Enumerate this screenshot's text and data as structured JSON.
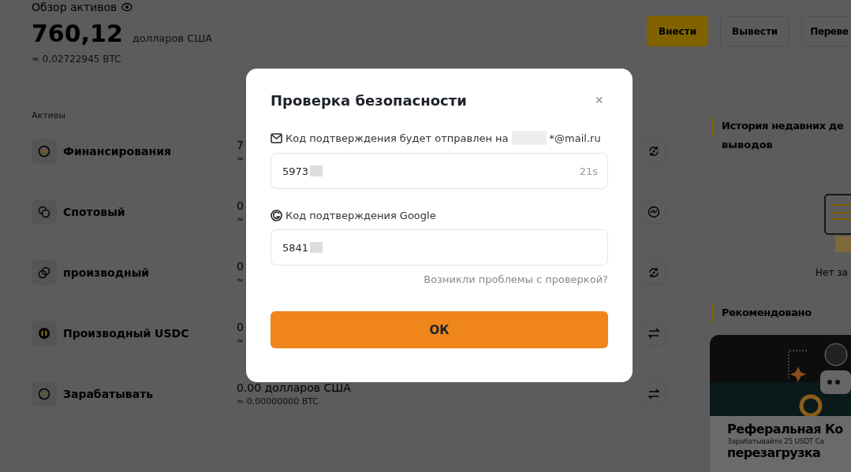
{
  "overview": {
    "title": "Обзор активов",
    "balance": "760,12",
    "currency": "долларов США",
    "btc": "≈ 0,02722945 BTC"
  },
  "actions": [
    {
      "label": "Внести",
      "primary": true
    },
    {
      "label": "Вывести",
      "primary": false
    },
    {
      "label": "Переве",
      "primary": false
    }
  ],
  "assets": {
    "heading": "Активы",
    "rows": [
      {
        "name": "Финансирования",
        "amount": "7",
        "approx": "≈"
      },
      {
        "name": "Спотовый",
        "amount": "0",
        "approx": "≈"
      },
      {
        "name": "производный",
        "amount": "0",
        "approx": "≈"
      },
      {
        "name": "Производный USDC",
        "amount": "0",
        "approx": "≈"
      },
      {
        "name": "Зарабатывать",
        "amount": "0.00 долларов США",
        "approx": "≈ 0.00000000 BTC"
      }
    ]
  },
  "history": {
    "title": "История недавних де",
    "title_line_2": "выводов",
    "empty": "Нет за"
  },
  "recommended": {
    "title": "Рекомендовано",
    "card_title": "Реферальная Ко",
    "card_description": "Зарабатывайте 25 USDT Са",
    "card_title_line_2": "перезагрузка"
  },
  "dialog": {
    "title": "Проверка безопасности",
    "close": "×",
    "email_label": "Код подтверждения будет отправлен на",
    "email_suffix": "*@mail.ru",
    "email_code": "5973",
    "timer": "21s",
    "google_label": "Код подтверждения Google",
    "google_code": "5841",
    "help_link": "Возникли проблемы с проверкой?",
    "submit": "ОК"
  }
}
